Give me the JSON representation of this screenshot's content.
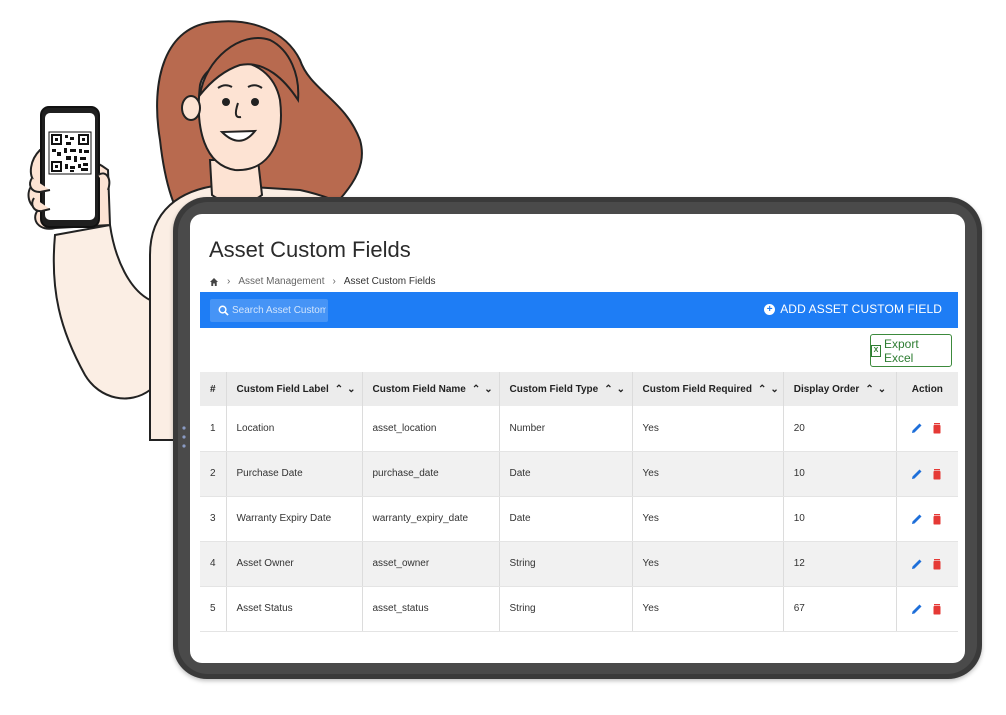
{
  "page": {
    "title": "Asset Custom Fields",
    "breadcrumb": [
      "Asset Management",
      "Asset Custom Fields"
    ]
  },
  "toolbar": {
    "search_placeholder": "Search Asset Custom Fi",
    "add_label": "ADD ASSET CUSTOM FIELD",
    "accent_color": "#1e7df5"
  },
  "export": {
    "label": "Export Excel",
    "color": "#2e7d32"
  },
  "table": {
    "headers": {
      "num": "#",
      "label": "Custom Field Label",
      "name": "Custom Field Name",
      "type": "Custom Field Type",
      "required": "Custom Field Required",
      "order": "Display Order",
      "action": "Action"
    },
    "rows": [
      {
        "num": "1",
        "label": "Location",
        "name": "asset_location",
        "type": "Number",
        "required": "Yes",
        "order": "20"
      },
      {
        "num": "2",
        "label": "Purchase Date",
        "name": "purchase_date",
        "type": "Date",
        "required": "Yes",
        "order": "10"
      },
      {
        "num": "3",
        "label": "Warranty Expiry Date",
        "name": "warranty_expiry_date",
        "type": "Date",
        "required": "Yes",
        "order": "10"
      },
      {
        "num": "4",
        "label": "Asset Owner",
        "name": "asset_owner",
        "type": "String",
        "required": "Yes",
        "order": "12"
      },
      {
        "num": "5",
        "label": "Asset Status",
        "name": "asset_status",
        "type": "String",
        "required": "Yes",
        "order": "67"
      }
    ],
    "edit_icon_color": "#1e6fd9",
    "delete_icon_color": "#e53935"
  }
}
